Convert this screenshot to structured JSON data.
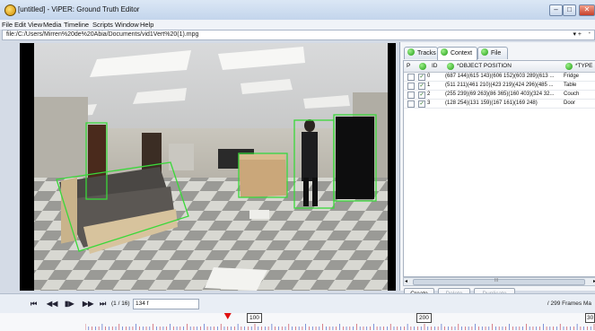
{
  "window": {
    "title": "[untitled] - ViPER: Ground Truth Editor"
  },
  "menu": [
    "File",
    "Edit",
    "View",
    "Media",
    "Timeline",
    "Scripts",
    "Window",
    "Help"
  ],
  "path_bar": {
    "value": "file:/C:/Users/Mirren%20de%20Abia/Documents/vid1Vert%20(1).mpg",
    "plus": "+",
    "minus": "-"
  },
  "tabs": [
    {
      "label": "Tracks",
      "active": false
    },
    {
      "label": "Context",
      "active": true
    },
    {
      "label": "File",
      "active": false
    }
  ],
  "table": {
    "headers": {
      "p": "P",
      "id": "ID",
      "position": "*OBJECT POSITION",
      "type": "*TYPE"
    },
    "rows": [
      {
        "id": "0",
        "position": "(687 144)(615 143)(606 152)(603 289)(613 ...",
        "type": "Fridge"
      },
      {
        "id": "1",
        "position": "(511 211)(461 210)(423 219)(424 296)(485 ...",
        "type": "Table"
      },
      {
        "id": "2",
        "position": "(255 239)(69 263)(86 365)(160 403)(324 32...",
        "type": "Couch"
      },
      {
        "id": "3",
        "position": "(128 254)(131 159)(167 161)(169 248)",
        "type": "Door"
      }
    ],
    "scrollbar_label": "III"
  },
  "buttons": {
    "create": "Create",
    "delete": "Delete",
    "duplicate": "Duplicate"
  },
  "transport": {
    "rate": "(1 / 16)",
    "frame": "134 f",
    "frames_total": "/ 299 Frames Ma"
  },
  "timeline": {
    "labels": [
      "100",
      "200",
      "30"
    ],
    "playhead_frame": 134
  },
  "colors": {
    "annotation": "#3ad83a",
    "playhead": "#e01010"
  }
}
